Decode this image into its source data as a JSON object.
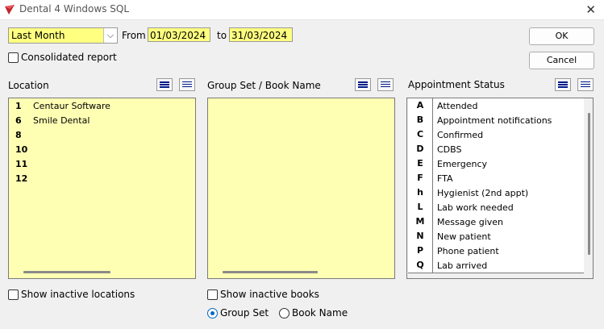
{
  "window": {
    "title": "Dental 4 Windows SQL"
  },
  "period": {
    "selected": "Last Month",
    "from_label": "From",
    "from_value": "01/03/2024",
    "to_label": "to",
    "to_value": "31/03/2024"
  },
  "consolidated_label": "Consolidated report",
  "buttons": {
    "ok": "OK",
    "cancel": "Cancel"
  },
  "location": {
    "label": "Location",
    "items": [
      {
        "code": "1",
        "name": "Centaur Software"
      },
      {
        "code": "6",
        "name": "Smile Dental"
      },
      {
        "code": "8",
        "name": ""
      },
      {
        "code": "10",
        "name": ""
      },
      {
        "code": "11",
        "name": ""
      },
      {
        "code": "12",
        "name": ""
      }
    ],
    "show_inactive_label": "Show inactive locations"
  },
  "groupset": {
    "label": "Group Set / Book Name",
    "show_inactive_label": "Show inactive books",
    "radio_group_set": "Group Set",
    "radio_book_name": "Book Name"
  },
  "appointment_status": {
    "label": "Appointment Status",
    "items": [
      {
        "code": "A",
        "name": "Attended"
      },
      {
        "code": "B",
        "name": "Appointment notifications"
      },
      {
        "code": "C",
        "name": "Confirmed"
      },
      {
        "code": "D",
        "name": "CDBS"
      },
      {
        "code": "E",
        "name": "Emergency"
      },
      {
        "code": "F",
        "name": "FTA"
      },
      {
        "code": "h",
        "name": "Hygienist (2nd appt)"
      },
      {
        "code": "L",
        "name": "Lab work needed"
      },
      {
        "code": "M",
        "name": "Message given"
      },
      {
        "code": "N",
        "name": "New patient"
      },
      {
        "code": "P",
        "name": "Phone patient"
      },
      {
        "code": "Q",
        "name": "Lab arrived"
      }
    ]
  },
  "colors": {
    "field_yellow": "#ffff80",
    "list_yellow": "#ffffb4",
    "icon_blue": "#001a8a",
    "radio_blue": "#0067c0"
  }
}
